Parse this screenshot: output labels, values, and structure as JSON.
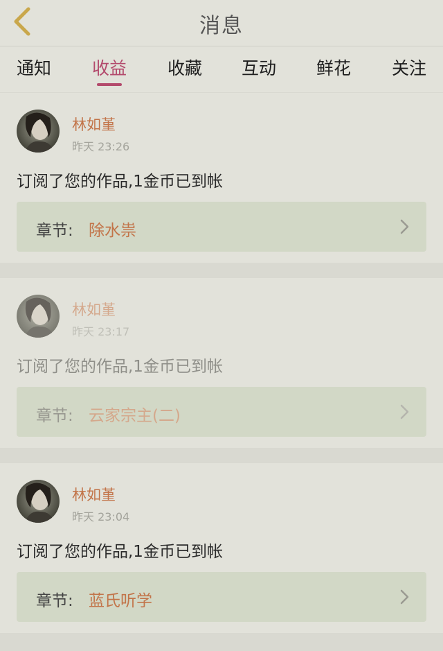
{
  "header": {
    "title": "消息"
  },
  "tabs": [
    {
      "label": "通知",
      "active": false
    },
    {
      "label": "收益",
      "active": true
    },
    {
      "label": "收藏",
      "active": false
    },
    {
      "label": "互动",
      "active": false
    },
    {
      "label": "鲜花",
      "active": false
    },
    {
      "label": "关注",
      "active": false
    }
  ],
  "notifications": [
    {
      "name": "林如堇",
      "time": "昨天 23:26",
      "message": "订阅了您的作品,1金币已到帐",
      "chapter_label": "章节:",
      "chapter_title": "除水祟"
    },
    {
      "name": "林如堇",
      "time": "昨天 23:17",
      "message": "订阅了您的作品,1金币已到帐",
      "chapter_label": "章节:",
      "chapter_title": "云家宗主(二)"
    },
    {
      "name": "林如堇",
      "time": "昨天 23:04",
      "message": "订阅了您的作品,1金币已到帐",
      "chapter_label": "章节:",
      "chapter_title": "蓝氏听学"
    }
  ],
  "colors": {
    "accent": "#b34a6c",
    "name_orange": "#c27449",
    "chapter_box": "#d2d8c6"
  },
  "icons": {
    "back": "chevron-left-icon",
    "chapter_arrow": "chevron-right-icon"
  }
}
